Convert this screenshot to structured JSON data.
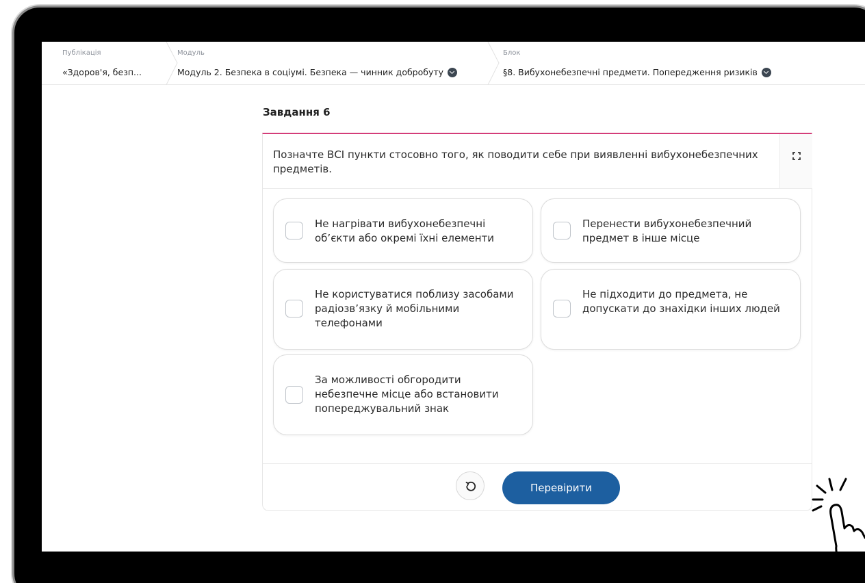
{
  "breadcrumbs": [
    {
      "label": "Публікація",
      "value": "«Здоров'я, безп..."
    },
    {
      "label": "Модуль",
      "value": "Модуль 2. Безпека в соціумі. Безпека — чинник добробуту"
    },
    {
      "label": "Блок",
      "value": "§8. Вибухонебезпечні предмети. Попередження ризиків"
    }
  ],
  "task": {
    "title": "Завдання 6",
    "question": "Позначте ВСІ пункти стосовно того, як поводити себе при виявленні вибухонебезпечних предметів.",
    "options": [
      {
        "text": "Не нагрівати вибухонебезпечні об’єкти або окремі їхні елементи",
        "checked": false
      },
      {
        "text": "Перенести вибухонебезпечний предмет в інше місце",
        "checked": false
      },
      {
        "text": "Не користуватися поблизу засобами радіозв’язку й мобільними телефонами",
        "checked": false
      },
      {
        "text": "Не підходити до предмета, не допускати до знахідки інших людей",
        "checked": false
      },
      {
        "text": "За можливості обгородити небезпечне місце або встановити попереджувальний знак",
        "checked": false
      }
    ],
    "check_label": "Перевірити"
  },
  "colors": {
    "accent_line": "#d43d79",
    "primary_button": "#1d5fa0"
  },
  "icons": {
    "reset": "reset-icon",
    "expand": "expand-icon",
    "dropdown": "chevron-down-icon",
    "cursor": "hand-pointer-icon"
  }
}
